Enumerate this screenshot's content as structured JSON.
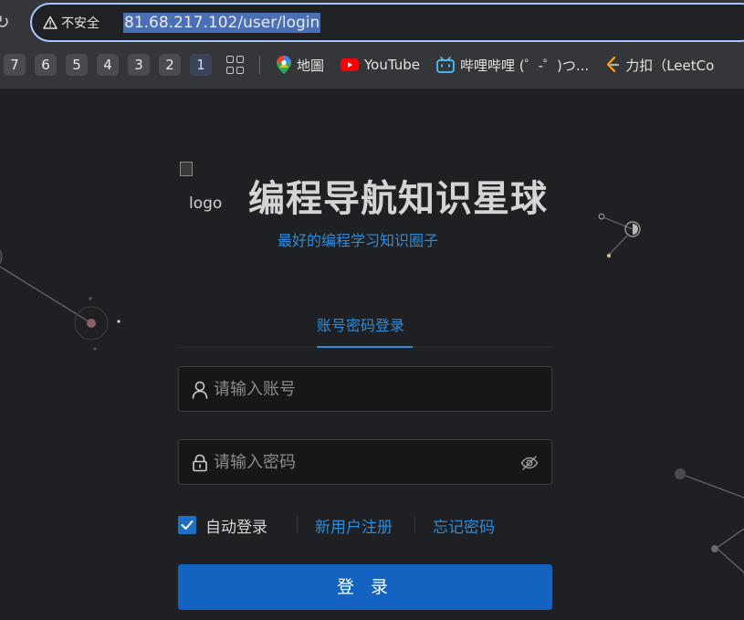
{
  "browser": {
    "security_label": "不安全",
    "url": "81.68.217.102/user/login",
    "numbered_tabs": [
      "7",
      "6",
      "5",
      "4",
      "3",
      "2",
      "1"
    ],
    "active_tab": "1",
    "bookmarks": [
      {
        "icon": "maps-icon",
        "label": "地圖"
      },
      {
        "icon": "youtube-icon",
        "label": "YouTube"
      },
      {
        "icon": "bilibili-icon",
        "label": "哔哩哔哩 (゜-゜)つ..."
      },
      {
        "icon": "leetcode-icon",
        "label": "力扣（LeetCo"
      }
    ]
  },
  "header": {
    "logo_alt": "logo",
    "title": "编程导航知识星球",
    "subtitle": "最好的编程学习知识圈子"
  },
  "login": {
    "tab_label": "账号密码登录",
    "username_placeholder": "请输入账号",
    "password_placeholder": "请输入密码",
    "auto_login_label": "自动登录",
    "auto_login_checked": true,
    "register_link": "新用户注册",
    "forgot_link": "忘记密码",
    "submit_label": "登 录"
  },
  "colors": {
    "accent": "#2e8bd8",
    "button": "#1463c0",
    "background": "#1f2023"
  }
}
